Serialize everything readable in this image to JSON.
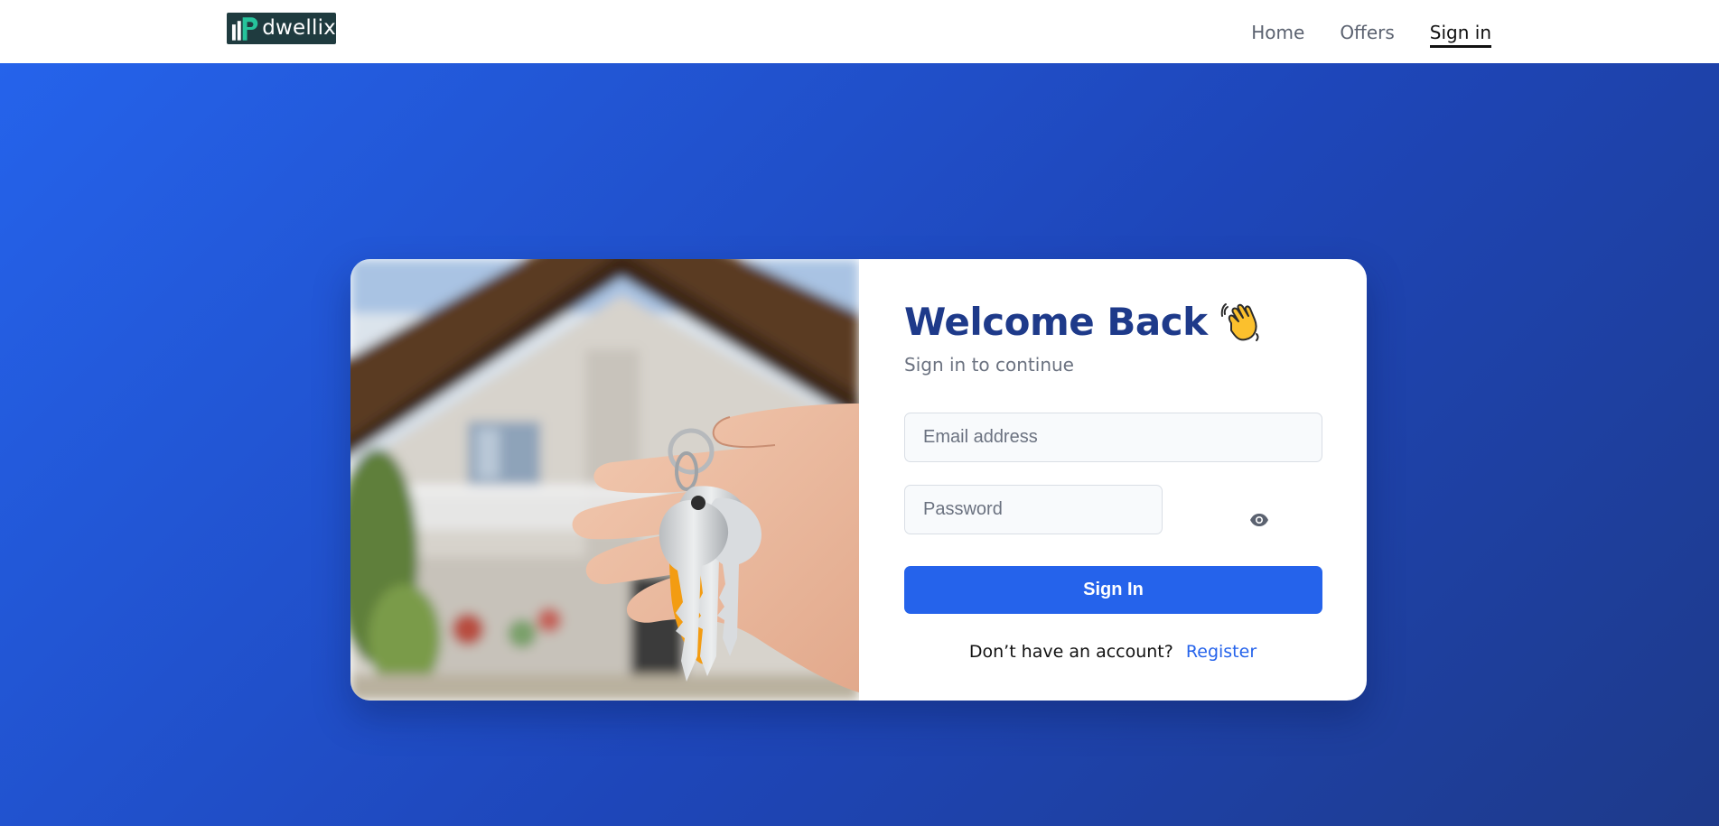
{
  "brand": {
    "name": "dwellix"
  },
  "nav": {
    "links": [
      {
        "label": "Home"
      },
      {
        "label": "Offers"
      },
      {
        "label": "Sign in",
        "active": true
      }
    ]
  },
  "login": {
    "title": "Welcome Back",
    "title_icon": "waving-hand-icon",
    "subtitle": "Sign in to continue",
    "email_placeholder": "Email address",
    "email_value": "",
    "password_placeholder": "Password",
    "password_value": "",
    "show_password_icon": "eye-icon",
    "submit_label": "Sign In",
    "register_prompt": "Don’t have an account?",
    "register_link": "Register"
  },
  "colors": {
    "accent": "#2563eb",
    "title": "#1e3a8a",
    "background_start": "#2563eb",
    "background_end": "#1e3a8a"
  }
}
